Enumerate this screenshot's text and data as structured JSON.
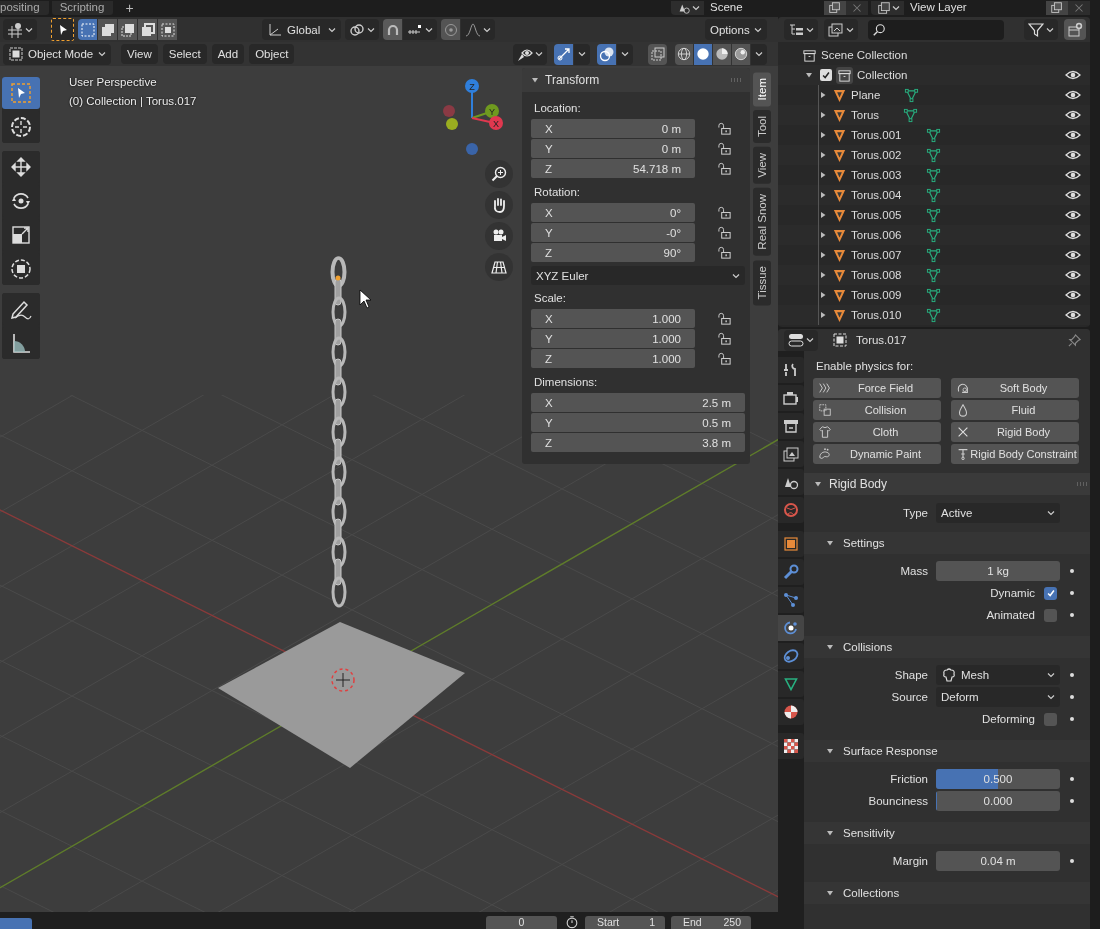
{
  "workspace_tabs": [
    {
      "label": "positing",
      "selected": false
    },
    {
      "label": "Scripting",
      "selected": false
    }
  ],
  "new_tab_button": "+",
  "scene": {
    "name": "Scene"
  },
  "view_layer": {
    "name": "View Layer"
  },
  "tool_header": {
    "select_modes": [
      {
        "selected": true
      },
      {
        "selected": false
      },
      {
        "selected": false
      },
      {
        "selected": false
      },
      {
        "selected": false
      }
    ],
    "orientation": "Global",
    "snap": false,
    "proportional_editing": false,
    "options": "Options"
  },
  "viewport_header": {
    "mode": "Object Mode",
    "menus": [
      "View",
      "Select",
      "Add",
      "Object"
    ],
    "gizmos": true,
    "overlays": true,
    "xray": false,
    "shading_modes": [
      {
        "kind": "wireframe",
        "selected": false
      },
      {
        "kind": "solid",
        "selected": true
      },
      {
        "kind": "material",
        "selected": false
      },
      {
        "kind": "rendered",
        "selected": false
      }
    ]
  },
  "viewport": {
    "perspective": "User Perspective",
    "context": "(0) Collection | Torus.017",
    "gizmo_axes": [
      {
        "label": "Z"
      },
      {
        "label": "Y"
      },
      {
        "label": "X"
      }
    ]
  },
  "toolbar": {
    "groups": [
      {
        "tools": [
          {
            "kind": "select_box",
            "selected": true
          },
          {
            "kind": "cursor",
            "selected": false
          }
        ]
      },
      {
        "tools": [
          {
            "kind": "move",
            "selected": false
          },
          {
            "kind": "rotate",
            "selected": false
          },
          {
            "kind": "scale",
            "selected": false
          },
          {
            "kind": "transform",
            "selected": false
          }
        ]
      },
      {
        "tools": [
          {
            "kind": "annotate",
            "selected": false
          },
          {
            "kind": "measure",
            "selected": false
          }
        ]
      }
    ]
  },
  "sidebar_tabs": [
    {
      "label": "Item",
      "selected": true
    },
    {
      "label": "Tool",
      "selected": false
    },
    {
      "label": "View",
      "selected": false
    },
    {
      "label": "Real Snow",
      "selected": false
    },
    {
      "label": "Tissue",
      "selected": false
    }
  ],
  "transform": {
    "title": "Transform",
    "expanded": true,
    "groups": [
      {
        "label": "Location:",
        "fields": [
          {
            "axis": "X",
            "value": "0 m",
            "locked": false
          },
          {
            "axis": "Y",
            "value": "0 m",
            "locked": false
          },
          {
            "axis": "Z",
            "value": "54.718 m",
            "locked": false
          }
        ]
      },
      {
        "label": "Rotation:",
        "fields": [
          {
            "axis": "X",
            "value": "0°",
            "locked": false
          },
          {
            "axis": "Y",
            "value": "-0°",
            "locked": false
          },
          {
            "axis": "Z",
            "value": "90°",
            "locked": false
          }
        ],
        "mode": "XYZ Euler"
      },
      {
        "label": "Scale:",
        "fields": [
          {
            "axis": "X",
            "value": "1.000",
            "locked": false
          },
          {
            "axis": "Y",
            "value": "1.000",
            "locked": false
          },
          {
            "axis": "Z",
            "value": "1.000",
            "locked": false
          }
        ]
      },
      {
        "label": "Dimensions:",
        "fields": [
          {
            "axis": "X",
            "value": "2.5 m"
          },
          {
            "axis": "Y",
            "value": "0.5 m"
          },
          {
            "axis": "Z",
            "value": "3.8 m"
          }
        ]
      }
    ]
  },
  "outliner": {
    "root": "Scene Collection",
    "collection": {
      "name": "Collection",
      "checked": true,
      "expanded": true,
      "visible": true,
      "children": [
        {
          "name": "Plane",
          "expanded": false,
          "visible": true
        },
        {
          "name": "Torus",
          "expanded": false,
          "visible": true
        },
        {
          "name": "Torus.001",
          "expanded": false,
          "visible": true
        },
        {
          "name": "Torus.002",
          "expanded": false,
          "visible": true
        },
        {
          "name": "Torus.003",
          "expanded": false,
          "visible": true
        },
        {
          "name": "Torus.004",
          "expanded": false,
          "visible": true
        },
        {
          "name": "Torus.005",
          "expanded": false,
          "visible": true
        },
        {
          "name": "Torus.006",
          "expanded": false,
          "visible": true
        },
        {
          "name": "Torus.007",
          "expanded": false,
          "visible": true
        },
        {
          "name": "Torus.008",
          "expanded": false,
          "visible": true
        },
        {
          "name": "Torus.009",
          "expanded": false,
          "visible": true
        },
        {
          "name": "Torus.010",
          "expanded": false,
          "visible": true
        }
      ]
    }
  },
  "properties": {
    "object": "Torus.017",
    "tab_groups": [
      {
        "tabs": [
          {
            "kind": "tool",
            "selected": false
          },
          {
            "kind": "render",
            "selected": false
          },
          {
            "kind": "output",
            "selected": false
          },
          {
            "kind": "view_layer",
            "selected": false
          },
          {
            "kind": "scene",
            "selected": false
          },
          {
            "kind": "world",
            "selected": false
          }
        ]
      },
      {
        "tabs": [
          {
            "kind": "object",
            "selected": false
          },
          {
            "kind": "modifiers",
            "selected": false
          },
          {
            "kind": "particles",
            "selected": false
          },
          {
            "kind": "physics",
            "selected": true
          },
          {
            "kind": "constraints",
            "selected": false
          },
          {
            "kind": "data",
            "selected": false
          },
          {
            "kind": "material",
            "selected": false
          }
        ]
      },
      {
        "tabs": [
          {
            "kind": "texture",
            "selected": false
          }
        ]
      }
    ],
    "physics_label": "Enable physics for:",
    "physics_buttons": [
      {
        "label": "Force Field",
        "kind": "force_field",
        "enabled": false
      },
      {
        "label": "Soft Body",
        "kind": "soft_body",
        "enabled": false
      },
      {
        "label": "Collision",
        "kind": "collision",
        "enabled": false
      },
      {
        "label": "Fluid",
        "kind": "fluid",
        "enabled": false
      },
      {
        "label": "Cloth",
        "kind": "cloth",
        "enabled": false
      },
      {
        "label": "Rigid Body",
        "enabled": true
      },
      {
        "label": "Dynamic Paint",
        "kind": "dynamic_paint",
        "enabled": false
      },
      {
        "label": "Rigid Body Constraint",
        "kind": "rigid_body_constraint",
        "enabled": false
      }
    ],
    "rigid_body": {
      "title": "Rigid Body",
      "expanded": true,
      "type_label": "Type",
      "type": "Active",
      "subpanels": [
        {
          "title": "Settings",
          "expanded": true,
          "rows": [
            {
              "kind": "number",
              "label": "Mass",
              "value": "1 kg"
            },
            {
              "kind": "checkbox",
              "label": "Dynamic",
              "checked": true
            },
            {
              "kind": "checkbox",
              "label": "Animated",
              "checked": false
            }
          ]
        },
        {
          "title": "Collisions",
          "expanded": true,
          "rows": [
            {
              "kind": "icon_dropdown",
              "label": "Shape",
              "value": "Mesh"
            },
            {
              "kind": "dropdown",
              "label": "Source",
              "value": "Deform"
            },
            {
              "kind": "checkbox",
              "label": "Deforming",
              "checked": false
            }
          ]
        },
        {
          "title": "Surface Response",
          "expanded": true,
          "rows": [
            {
              "kind": "slider",
              "label": "Friction",
              "value": "0.500",
              "level": 0.5
            },
            {
              "kind": "slider",
              "label": "Bounciness",
              "value": "0.000",
              "level": 0
            }
          ]
        },
        {
          "title": "Sensitivity",
          "expanded": true,
          "rows": [
            {
              "kind": "number",
              "label": "Margin",
              "value": "0.04 m"
            }
          ]
        },
        {
          "title": "Collections",
          "expanded": true
        }
      ]
    }
  },
  "timeline": {
    "current_frame": "0",
    "start_label": "Start",
    "start": "1",
    "end_label": "End",
    "end": "250"
  }
}
